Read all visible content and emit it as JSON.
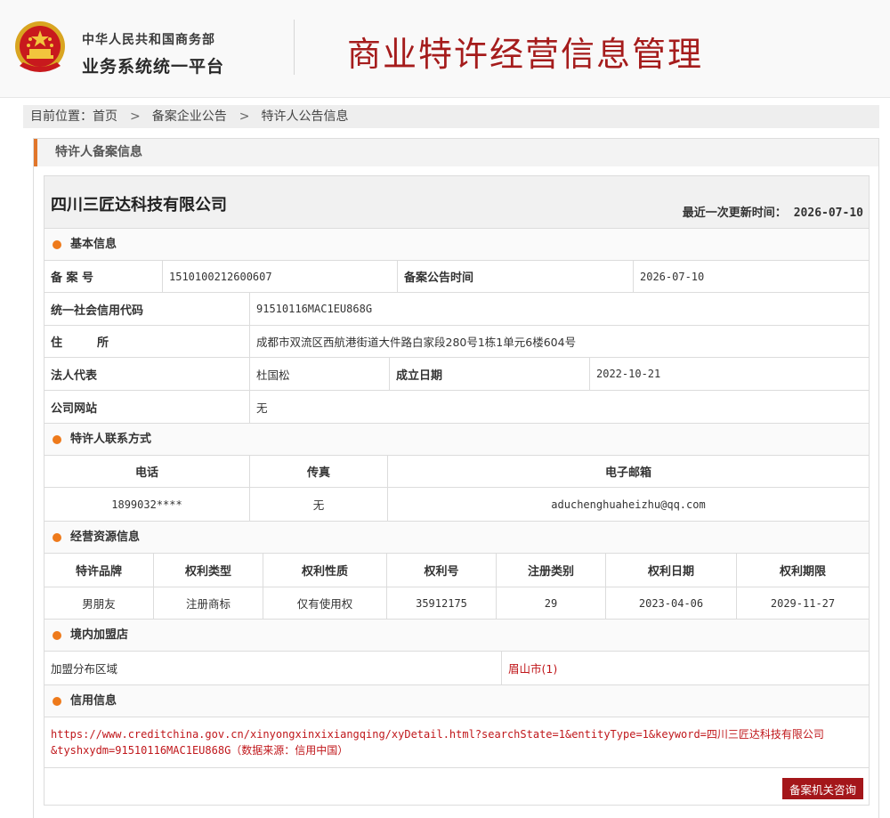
{
  "header": {
    "org_line1": "中华人民共和国商务部",
    "org_line2": "业务系统统一平台",
    "site_title": "商业特许经营信息管理"
  },
  "breadcrumb": {
    "prefix": "目前位置：",
    "items": [
      "首页",
      "备案企业公告",
      "特许人公告信息"
    ],
    "separator": ">"
  },
  "panel": {
    "title": "特许人备案信息"
  },
  "company": {
    "name": "四川三匠达科技有限公司",
    "update_label": "最近一次更新时间：",
    "update_value": "2026-07-10"
  },
  "basic": {
    "section": "基本信息",
    "record_no_label": "备 案 号",
    "record_no": "1510100212600607",
    "announce_label": "备案公告时间",
    "announce_date": "2026-07-10",
    "credit_code_label": "统一社会信用代码",
    "credit_code": "91510116MAC1EU868G",
    "address_label": "住　　　所",
    "address": "成都市双流区西航港街道大件路白家段280号1栋1单元6楼604号",
    "legal_label": "法人代表",
    "legal": "杜国松",
    "founded_label": "成立日期",
    "founded": "2022-10-21",
    "website_label": "公司网站",
    "website": "无"
  },
  "contact": {
    "section": "特许人联系方式",
    "headers": [
      "电话",
      "传真",
      "电子邮箱"
    ],
    "phone": "1899032****",
    "fax": "无",
    "email": "aduchenghuaheizhu@qq.com"
  },
  "resource": {
    "section": "经营资源信息",
    "headers": [
      "特许品牌",
      "权利类型",
      "权利性质",
      "权利号",
      "注册类别",
      "权利日期",
      "权利期限"
    ],
    "row": [
      "男朋友",
      "注册商标",
      "仅有使用权",
      "35912175",
      "29",
      "2023-04-06",
      "2029-11-27"
    ]
  },
  "stores": {
    "section": "境内加盟店",
    "area_label": "加盟分布区域",
    "area_value": "眉山市(1)"
  },
  "credit": {
    "section": "信用信息",
    "link_line1": "https://www.creditchina.gov.cn/xinyongxinxixiangqing/xyDetail.html?searchState=1&entityType=1&keyword=四川三匠达科技有限公司",
    "link_line2": "&tyshxydm=91510116MAC1EU868G（数据来源：信用中国）"
  },
  "consult_button": "备案机关咨询",
  "colors": {
    "accent_red": "#a4161a",
    "title_red": "#a51c1c",
    "orange": "#ee7a1b"
  }
}
